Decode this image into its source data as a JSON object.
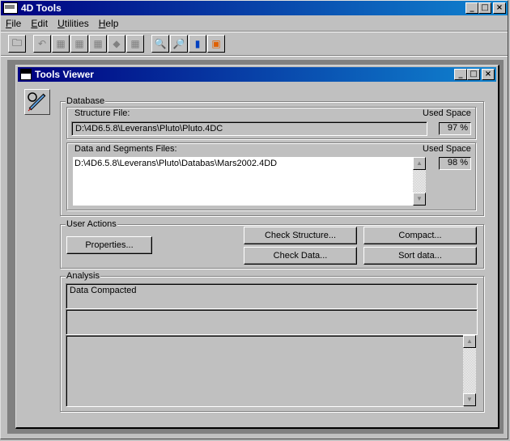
{
  "app": {
    "title": "4D Tools",
    "icon": "4d-tools-app-icon",
    "window_controls": {
      "minimize": "_",
      "maximize": "□",
      "close": "×"
    }
  },
  "menubar": {
    "items": [
      {
        "label": "File",
        "accel": "F",
        "rest": "ile"
      },
      {
        "label": "Edit",
        "accel": "E",
        "rest": "dit"
      },
      {
        "label": "Utilities",
        "accel": "U",
        "rest": "tilities"
      },
      {
        "label": "Help",
        "accel": "H",
        "rest": "elp"
      }
    ]
  },
  "toolbar": {
    "buttons": [
      {
        "icon": "open-folder-icon",
        "glyph": "🗀",
        "enabled": true
      },
      {
        "icon": "undo-icon",
        "glyph": "↶",
        "enabled": false
      },
      {
        "icon": "tool-1-icon",
        "glyph": "▦",
        "enabled": false
      },
      {
        "icon": "tool-2-icon",
        "glyph": "▦",
        "enabled": false
      },
      {
        "icon": "tool-3-icon",
        "glyph": "▦",
        "enabled": false
      },
      {
        "icon": "tool-4-icon",
        "glyph": "◆",
        "enabled": false
      },
      {
        "icon": "tool-5-icon",
        "glyph": "▦",
        "enabled": false
      },
      {
        "icon": "check-magnifier-icon",
        "glyph": "🔍",
        "enabled": true
      },
      {
        "icon": "search-magnifier-icon",
        "glyph": "🔎",
        "enabled": true
      },
      {
        "icon": "database-cart-icon",
        "glyph": "▮",
        "enabled": true
      },
      {
        "icon": "backup-icon",
        "glyph": "▣",
        "enabled": true
      }
    ]
  },
  "child_window": {
    "title": "Tools Viewer",
    "icon": "tools-viewer-icon",
    "side_icon": "stethoscope-syringe-icon",
    "window_controls": {
      "minimize": "_",
      "maximize": "□",
      "close": "×"
    }
  },
  "database": {
    "label": "Database",
    "structure": {
      "label": "Structure File:",
      "used_label": "Used Space",
      "path": "D:\\4D6.5.8\\Leverans\\Pluto\\Pluto.4DC",
      "used_space": "97 %"
    },
    "data": {
      "label": "Data and Segments Files:",
      "used_label": "Used Space",
      "files": [
        "D:\\4D6.5.8\\Leverans\\Pluto\\Databas\\Mars2002.4DD"
      ],
      "used_space": "98 %"
    }
  },
  "user_actions": {
    "label": "User Actions",
    "properties": "Properties...",
    "check_structure": "Check Structure...",
    "compact": "Compact...",
    "check_data": "Check Data...",
    "sort_data": "Sort data..."
  },
  "analysis": {
    "label": "Analysis",
    "line1": "Data Compacted",
    "line2": "",
    "details": ""
  }
}
